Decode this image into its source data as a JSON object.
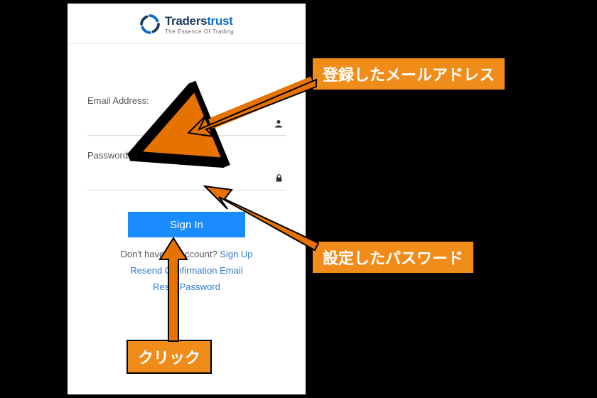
{
  "logo": {
    "name_dark": "Traders",
    "name_blue": "trust",
    "tagline": "The Essence Of Trading"
  },
  "form": {
    "email_label": "Email Address:",
    "email_value": "",
    "password_label": "Password:",
    "password_value": "",
    "signin_button": "Sign In",
    "no_account_text": "Don't have an account? ",
    "signup_link": "Sign Up",
    "resend_link": "Resend Confirmation Email",
    "reset_link": "Reset Password"
  },
  "annotations": {
    "email_callout": "登録したメールアドレス",
    "password_callout": "設定したパスワード",
    "click_callout": "クリック"
  }
}
